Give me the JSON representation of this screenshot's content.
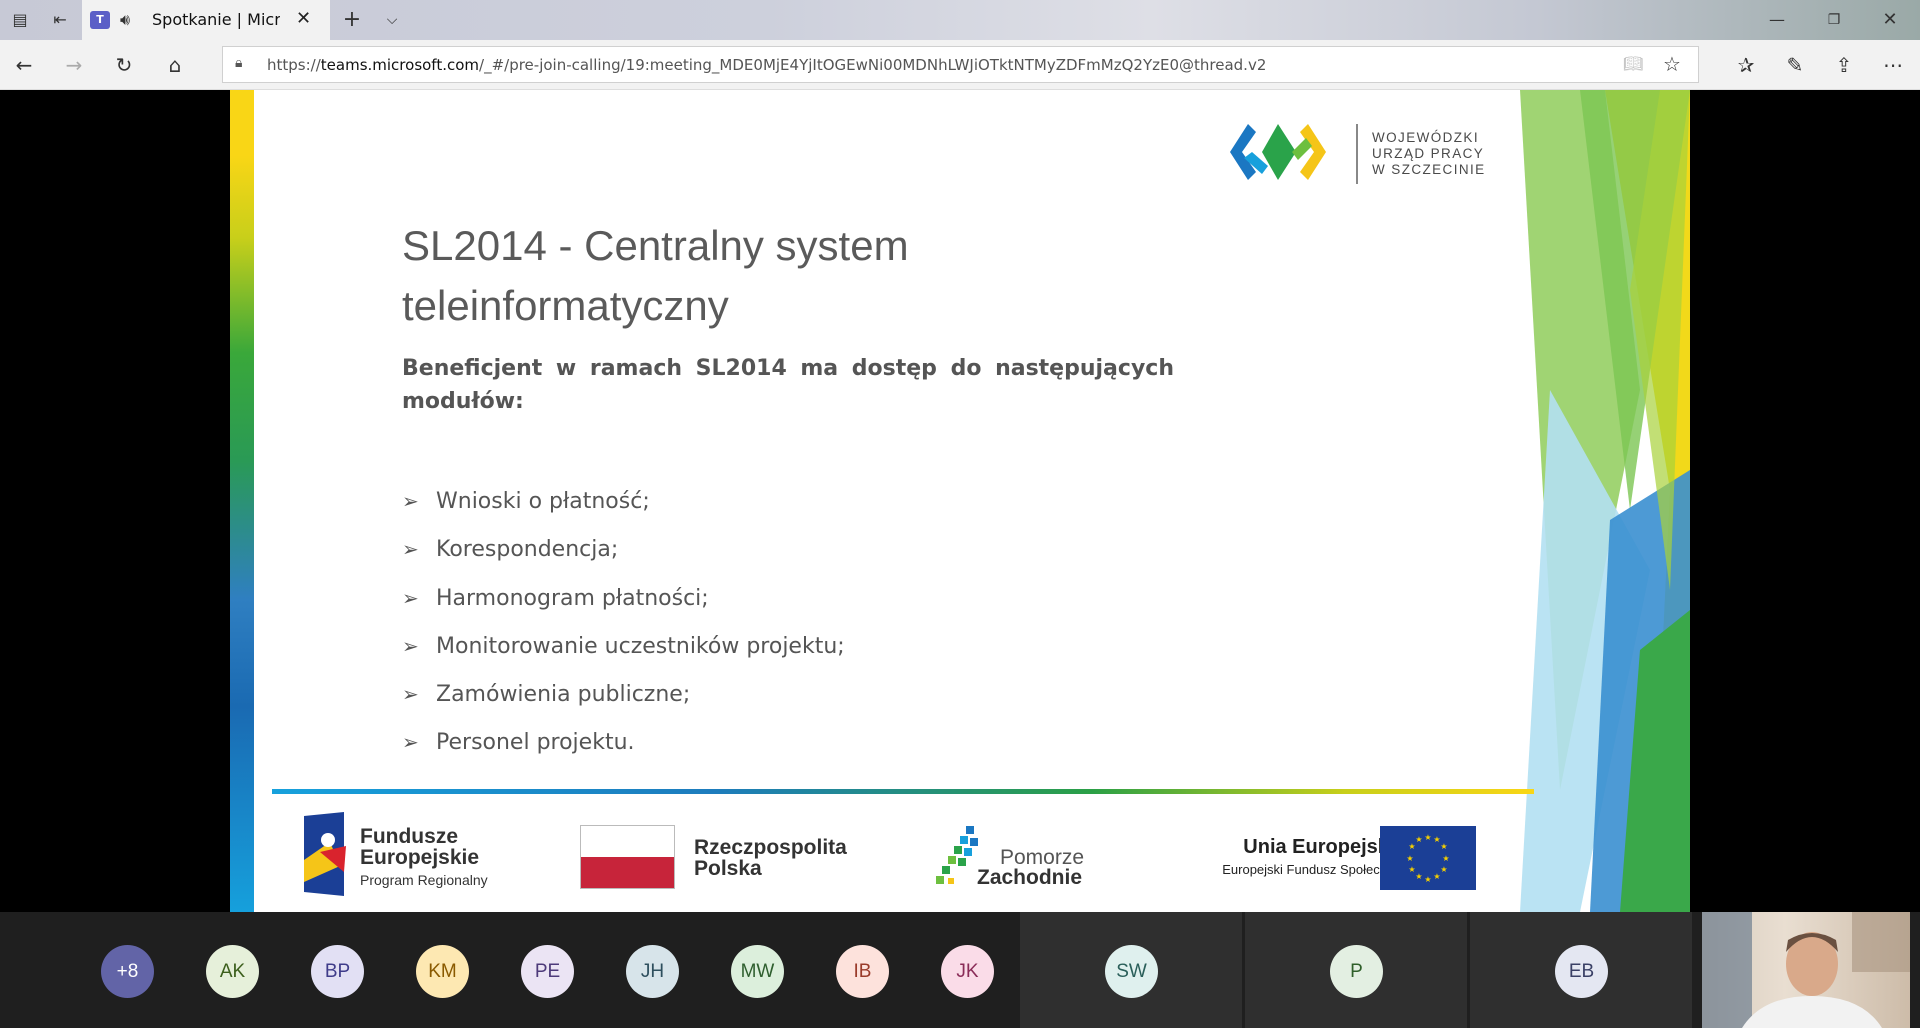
{
  "browser": {
    "tab_title": "Spotkanie | Microsoft Teams",
    "url_prefix": "https://",
    "url_domain": "teams.microsoft.com",
    "url_path": "/_#/pre-join-calling/19:meeting_MDE0MjE4YjItOGEwNi00MDNhLWJiOTktNTMyZDFmMzQ2YzE0@thread.v2"
  },
  "slide": {
    "logo_text": [
      "WOJEWÓDZKI",
      "URZĄD PRACY",
      "W  SZCZECINIE"
    ],
    "title": "SL2014 - Centralny system teleinformatyczny",
    "subtitle": "Beneficjent w ramach SL2014 ma dostęp do następujących modułów:",
    "bullets": [
      "Wnioski o płatność;",
      "Korespondencja;",
      "Harmonogram płatności;",
      "Monitorowanie uczestników projektu;",
      "Zamówienia publiczne;",
      "Personel projektu."
    ],
    "footer": {
      "fe_title": "Fundusze Europejskie",
      "fe_sub": "Program Regionalny",
      "pl_text": "Rzeczpospolita Polska",
      "pz_line1": "Pomorze",
      "pz_line2": "Zachodnie",
      "ue_title": "Unia Europejska",
      "ue_sub": "Europejski Fundusz Społeczny"
    }
  },
  "participants": [
    {
      "initials": "+8",
      "bg": "#6264a7",
      "fg": "#ffffff"
    },
    {
      "initials": "AK",
      "bg": "#e6f0da",
      "fg": "#3c5f1c"
    },
    {
      "initials": "BP",
      "bg": "#e2e0f4",
      "fg": "#3f3c8a"
    },
    {
      "initials": "KM",
      "bg": "#fde8b2",
      "fg": "#8a5a00"
    },
    {
      "initials": "PE",
      "bg": "#ebe4f4",
      "fg": "#4d3a7a"
    },
    {
      "initials": "JH",
      "bg": "#d7e4ea",
      "fg": "#2e4f5e"
    },
    {
      "initials": "MW",
      "bg": "#dcefdc",
      "fg": "#2f5f2f"
    },
    {
      "initials": "IB",
      "bg": "#fde2dc",
      "fg": "#9a3b2a"
    },
    {
      "initials": "JK",
      "bg": "#fadce8",
      "fg": "#8a2c58"
    },
    {
      "initials": "SW",
      "bg": "#dff0ee",
      "fg": "#2a5f5a"
    },
    {
      "initials": "P",
      "bg": "#e3efe2",
      "fg": "#2f5f2a"
    },
    {
      "initials": "EB",
      "bg": "#e4e7f2",
      "fg": "#3a4066"
    }
  ]
}
